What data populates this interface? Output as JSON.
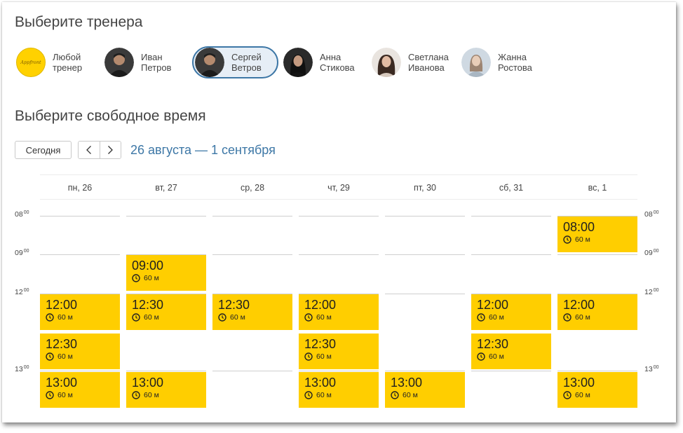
{
  "headings": {
    "choose_trainer": "Выберите тренера",
    "choose_time": "Выберите свободное время"
  },
  "trainers": [
    {
      "line1": "Любой",
      "line2": "тренер",
      "avatar_text": "Appfront",
      "avatar_color": "#ffd100"
    },
    {
      "line1": "Иван",
      "line2": "Петров"
    },
    {
      "line1": "Сергей",
      "line2": "Ветров",
      "selected": true
    },
    {
      "line1": "Анна",
      "line2": "Стикова"
    },
    {
      "line1": "Светлана",
      "line2": "Иванова"
    },
    {
      "line1": "Жанна",
      "line2": "Ростова"
    }
  ],
  "controls": {
    "today_label": "Сегодня",
    "prev_icon": "chevron-left-icon",
    "next_icon": "chevron-right-icon",
    "date_range": "26 августа — 1 сентября"
  },
  "calendar": {
    "days": [
      "пн, 26",
      "вт, 27",
      "ср, 28",
      "чт, 29",
      "пт, 30",
      "сб, 31",
      "вс, 1"
    ],
    "time_labels": [
      {
        "hour": "08",
        "min": "00"
      },
      {
        "hour": "09",
        "min": "00"
      },
      {
        "hour": "12",
        "min": "00"
      },
      {
        "hour": "13",
        "min": "00"
      }
    ],
    "duration_label": "60 м",
    "slot_color": "#ffce00",
    "slots": [
      [
        null,
        null,
        "12:00",
        "12:30",
        "13:00"
      ],
      [
        null,
        "09:00",
        "12:30",
        null,
        "13:00"
      ],
      [
        null,
        null,
        "12:30",
        null,
        null
      ],
      [
        null,
        null,
        "12:00",
        "12:30",
        "13:00"
      ],
      [
        null,
        null,
        null,
        null,
        "13:00"
      ],
      [
        null,
        null,
        "12:00",
        "12:30",
        null
      ],
      [
        "08:00",
        null,
        "12:00",
        null,
        "13:00"
      ]
    ]
  }
}
